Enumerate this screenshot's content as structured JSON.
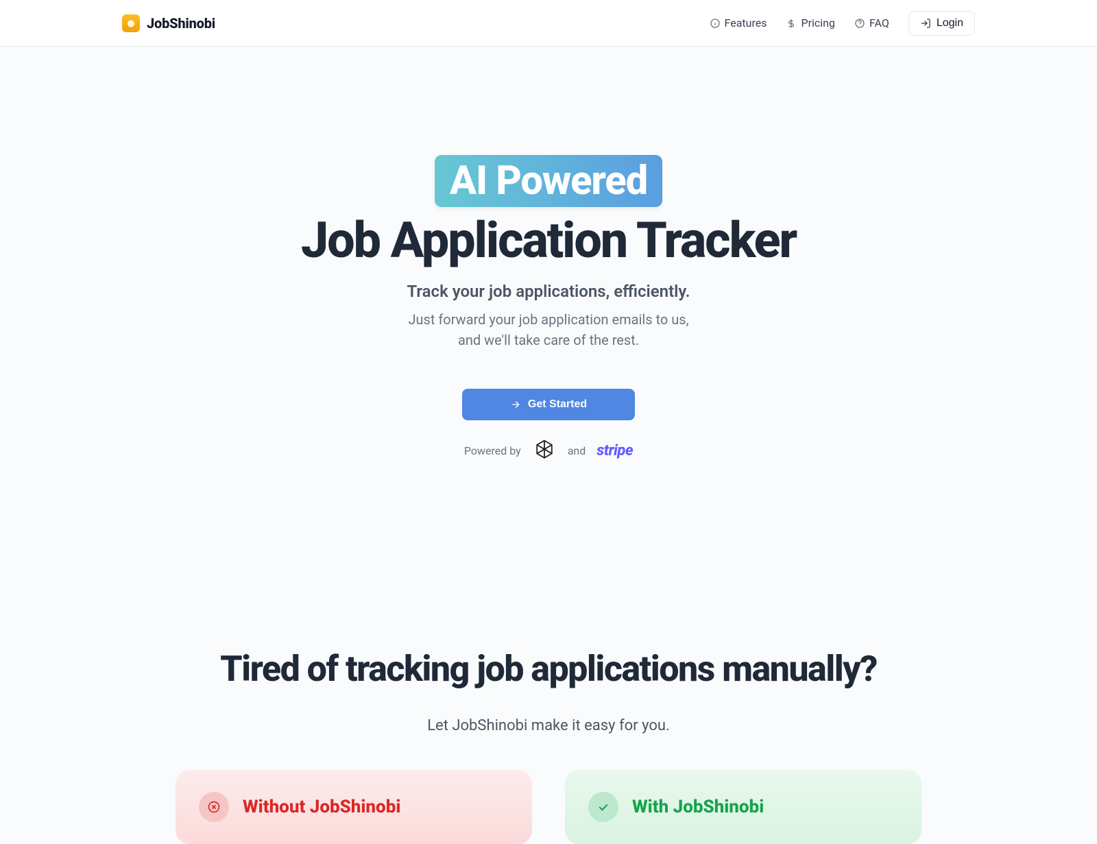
{
  "brand": {
    "name": "JobShinobi"
  },
  "nav": {
    "features": "Features",
    "pricing": "Pricing",
    "faq": "FAQ",
    "login": "Login"
  },
  "hero": {
    "badge": "AI Powered",
    "title": "Job Application Tracker",
    "tagline": "Track your job applications, efficiently.",
    "subtext1": "Just forward your job application emails to us,",
    "subtext2": "and we'll take care of the rest.",
    "cta": "Get Started",
    "powered_by": "Powered by",
    "and": "and",
    "stripe": "stripe"
  },
  "section2": {
    "title": "Tired of tracking job applications manually?",
    "sub": "Let JobShinobi make it easy for you.",
    "without": "Without JobShinobi",
    "with": "With JobShinobi"
  }
}
